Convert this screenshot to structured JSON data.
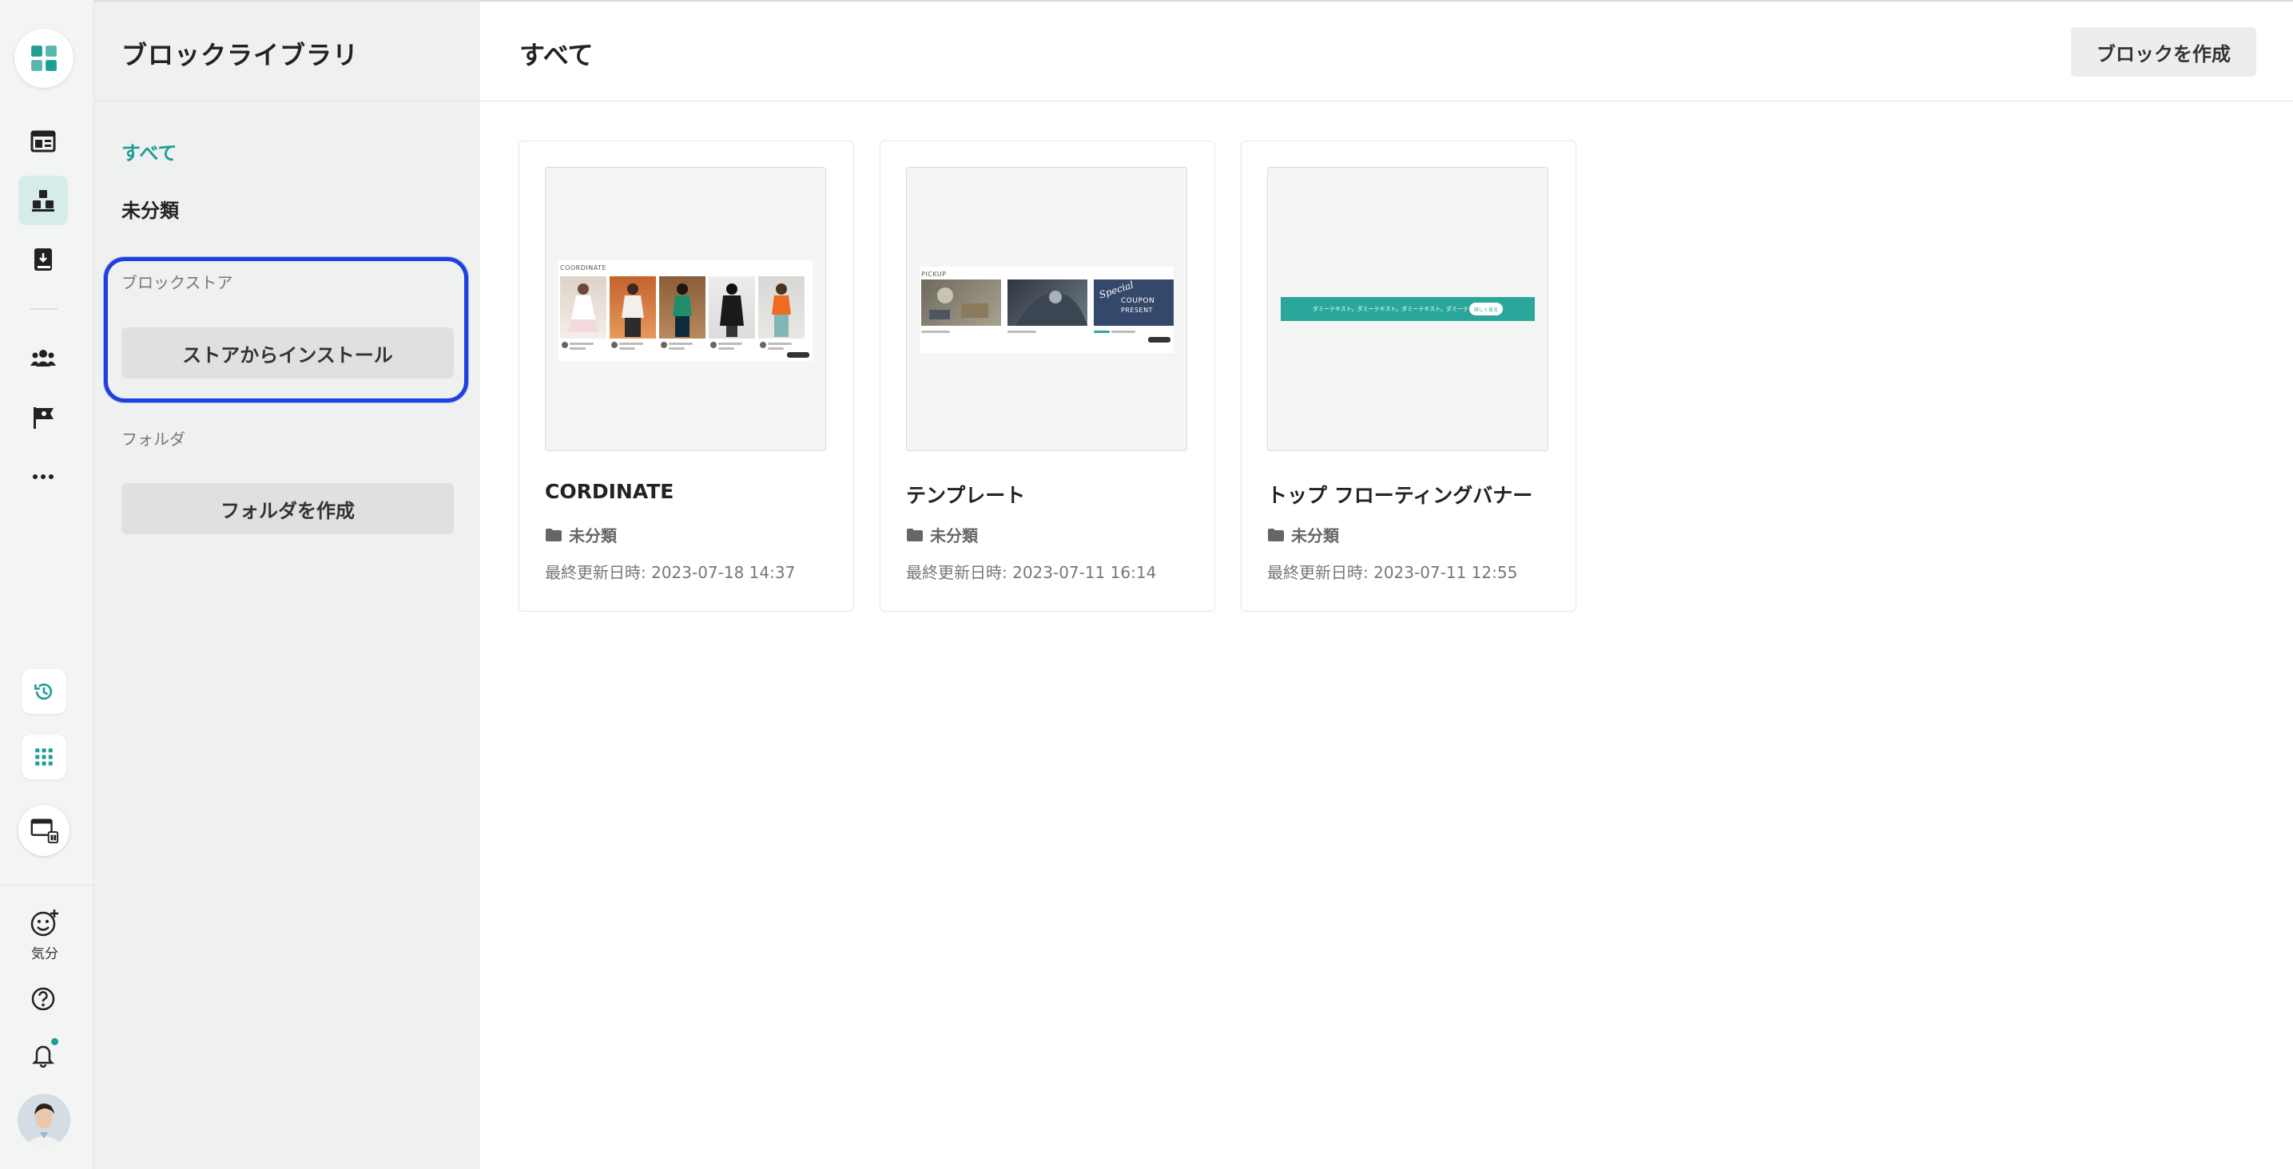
{
  "rail": {
    "icons": [
      "logo-icon",
      "dashboard-icon",
      "blocks-icon",
      "book-icon",
      "users-icon",
      "flag-icon",
      "more-icon",
      "history-icon",
      "apps-grid-icon",
      "preview-icon",
      "mood-icon",
      "help-icon",
      "bell-icon"
    ],
    "mood_label": "気分",
    "accent": "#1f9e93"
  },
  "sidebar": {
    "title": "ブロックライブラリ",
    "nav": [
      {
        "label": "すべて",
        "active": true
      },
      {
        "label": "未分類",
        "active": false
      }
    ],
    "store_section": "ブロックストア",
    "store_button": "ストアからインストール",
    "folder_section": "フォルダ",
    "folder_button": "フォルダを作成"
  },
  "main": {
    "title": "すべて",
    "create_button": "ブロックを作成",
    "cards": [
      {
        "title": "CORDINATE",
        "folder": "未分類",
        "updated": "最終更新日時: 2023-07-18 14:37",
        "thumb": {
          "label": "COORDINATE"
        }
      },
      {
        "title": "テンプレート",
        "folder": "未分類",
        "updated": "最終更新日時: 2023-07-11 16:14",
        "thumb": {
          "label": "PICKUP",
          "coupon_script": "Special",
          "coupon_title": "COUPON",
          "coupon_sub": "PRESENT"
        }
      },
      {
        "title": "トップ フローティングバナー",
        "folder": "未分類",
        "updated": "最終更新日時: 2023-07-11 12:55",
        "thumb": {
          "banner_text": "ダミーテキスト。ダミーテキスト。ダミーテキスト。ダミーテキスト。",
          "banner_button": "詳しく見る"
        }
      }
    ]
  }
}
